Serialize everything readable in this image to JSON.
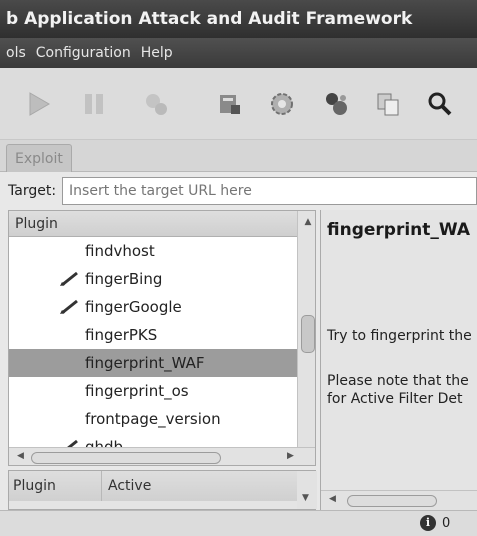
{
  "window": {
    "title": "b Application Attack and Audit Framework"
  },
  "menu": {
    "items": [
      "ols",
      "Configuration",
      "Help"
    ]
  },
  "toolbar": {
    "icons": [
      "play-icon",
      "pause-icon",
      "stop-icon",
      "wizard-icon",
      "gear-icon",
      "exploit-icon",
      "copy-icon",
      "search-icon"
    ]
  },
  "tabs": {
    "exploit": "Exploit"
  },
  "target": {
    "label": "Target:",
    "placeholder": "Insert the target URL here"
  },
  "plugins": {
    "header": "Plugin",
    "items": [
      {
        "label": "findvhost",
        "edited": false
      },
      {
        "label": "fingerBing",
        "edited": true
      },
      {
        "label": "fingerGoogle",
        "edited": true
      },
      {
        "label": "fingerPKS",
        "edited": false
      },
      {
        "label": "fingerprint_WAF",
        "edited": false,
        "selected": true
      },
      {
        "label": "fingerprint_os",
        "edited": false
      },
      {
        "label": "frontpage_version",
        "edited": false
      },
      {
        "label": "ghdb",
        "edited": true
      }
    ]
  },
  "options": {
    "col_plugin": "Plugin",
    "col_active": "Active"
  },
  "description": {
    "title": "fingerprint_WA",
    "line1": "Try to fingerprint the",
    "line2a": "Please note that the",
    "line2b": "for Active Filter Det"
  },
  "status": {
    "count": "0"
  }
}
